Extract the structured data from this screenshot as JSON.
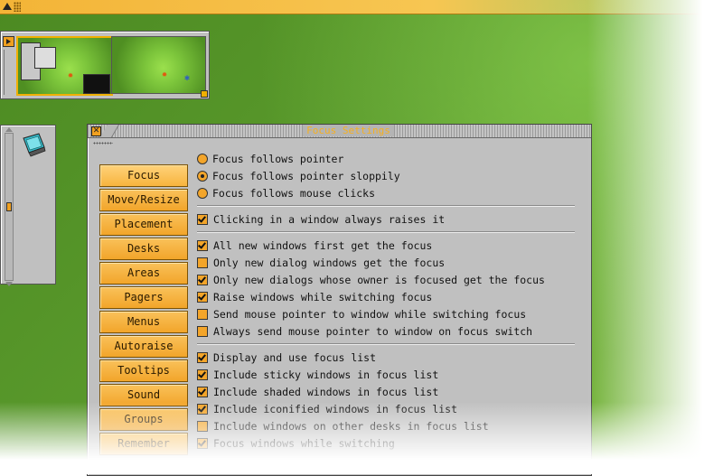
{
  "window": {
    "title": "Focus Settings",
    "close_glyph": "✕"
  },
  "tabs": [
    {
      "label": "Focus",
      "active": true
    },
    {
      "label": "Move/Resize"
    },
    {
      "label": "Placement"
    },
    {
      "label": "Desks"
    },
    {
      "label": "Areas"
    },
    {
      "label": "Pagers"
    },
    {
      "label": "Menus"
    },
    {
      "label": "Autoraise"
    },
    {
      "label": "Tooltips"
    },
    {
      "label": "Sound"
    },
    {
      "label": "Groups"
    },
    {
      "label": "Remember"
    }
  ],
  "focus_mode": {
    "options": [
      {
        "label": "Focus follows pointer",
        "selected": false
      },
      {
        "label": "Focus follows pointer sloppily",
        "selected": true
      },
      {
        "label": "Focus follows mouse clicks",
        "selected": false
      }
    ]
  },
  "group1": [
    {
      "label": "Clicking in a window always raises it",
      "checked": true
    }
  ],
  "group2": [
    {
      "label": "All new windows first get the focus",
      "checked": true
    },
    {
      "label": "Only new dialog windows get the focus",
      "checked": false
    },
    {
      "label": "Only new dialogs whose owner is focused get the focus",
      "checked": true
    },
    {
      "label": "Raise windows while switching focus",
      "checked": true
    },
    {
      "label": "Send mouse pointer to window while switching focus",
      "checked": false
    },
    {
      "label": "Always send mouse pointer to window on focus switch",
      "checked": false
    }
  ],
  "group3": [
    {
      "label": "Display and use focus list",
      "checked": true
    },
    {
      "label": "Include sticky windows in focus list",
      "checked": true
    },
    {
      "label": "Include shaded windows in focus list",
      "checked": true
    },
    {
      "label": "Include iconified windows in focus list",
      "checked": true
    },
    {
      "label": "Include windows on other desks in focus list",
      "checked": false
    },
    {
      "label": "Focus windows while switching",
      "checked": true
    }
  ],
  "colors": {
    "accent": "#f3a52a",
    "title_text": "#f6b020",
    "panel": "#c0c0c0"
  }
}
